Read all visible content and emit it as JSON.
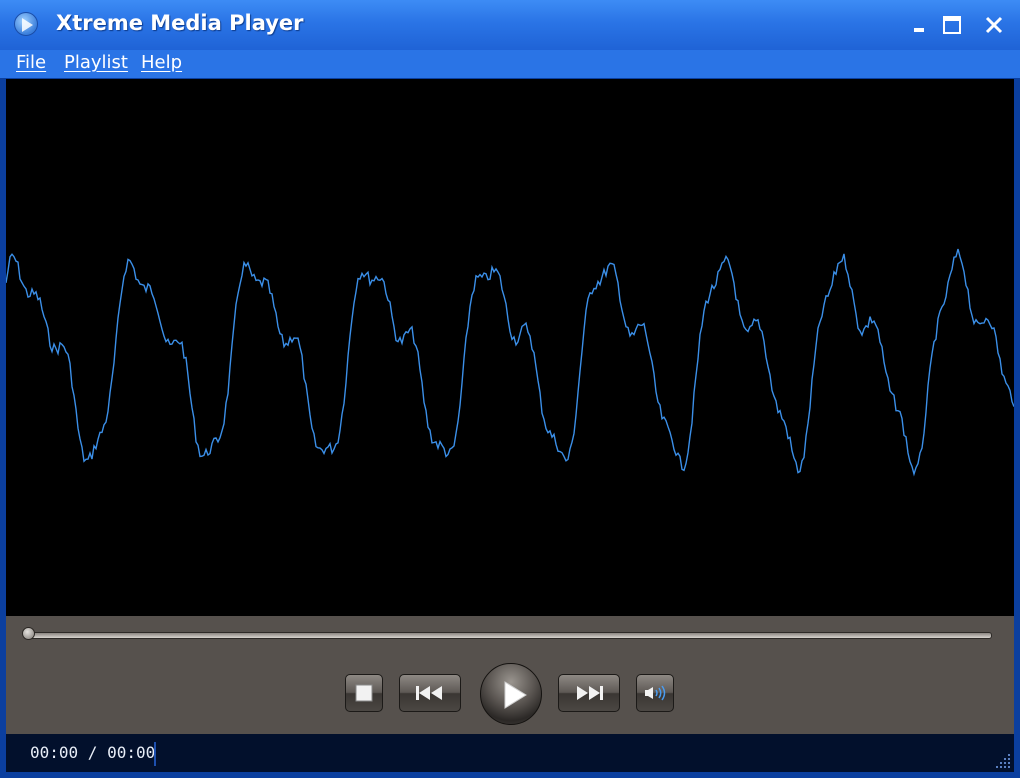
{
  "window": {
    "title": "Xtreme Media Player",
    "app_icon": "play-circle-icon",
    "controls": [
      "minimize-icon",
      "maximize-icon",
      "close-icon"
    ]
  },
  "menu": {
    "items": [
      {
        "label": "File"
      },
      {
        "label": "Playlist"
      },
      {
        "label": "Help"
      }
    ]
  },
  "visualizer": {
    "type": "waveform",
    "line_color": "#3b8fe8",
    "background": "#000000"
  },
  "seek": {
    "position": 0
  },
  "transport": {
    "buttons": [
      "stop-icon",
      "previous-icon",
      "play-icon",
      "next-icon",
      "volume-icon"
    ]
  },
  "status": {
    "time": "00:00 / 00:00"
  },
  "colors": {
    "titlebar": "#2a74e6",
    "controls_bg": "#56514d",
    "statusbar": "#02102c"
  }
}
